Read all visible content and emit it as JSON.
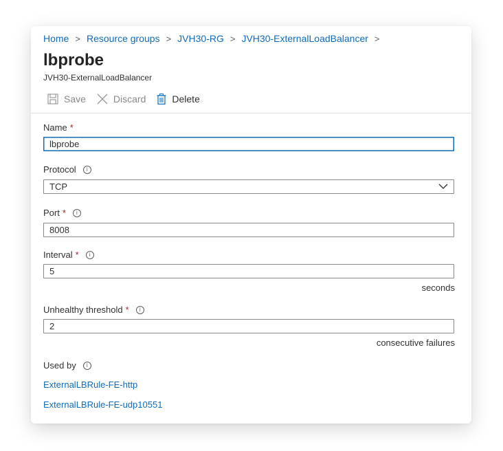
{
  "breadcrumb": [
    "Home",
    "Resource groups",
    "JVH30-RG",
    "JVH30-ExternalLoadBalancer"
  ],
  "breadcrumb_separator": ">",
  "title": "lbprobe",
  "subtitle": "JVH30-ExternalLoadBalancer",
  "toolbar": {
    "save": "Save",
    "discard": "Discard",
    "delete": "Delete"
  },
  "form": {
    "required_mark": "*",
    "info_mark": "i",
    "name": {
      "label": "Name",
      "value": "lbprobe"
    },
    "protocol": {
      "label": "Protocol",
      "value": "TCP"
    },
    "port": {
      "label": "Port",
      "value": "8008"
    },
    "interval": {
      "label": "Interval",
      "value": "5",
      "unit": "seconds"
    },
    "unhealthy": {
      "label": "Unhealthy threshold",
      "value": "2",
      "unit": "consecutive failures"
    },
    "used_by": {
      "label": "Used by",
      "links": [
        "ExternalLBRule-FE-http",
        "ExternalLBRule-FE-udp10551"
      ]
    }
  },
  "colors": {
    "accent": "#0f6cbd",
    "required": "#a4262c"
  },
  "icons": {
    "save": "save-icon",
    "discard": "close-icon",
    "delete": "trash-icon",
    "protocol_dropdown": "chevron-down-icon",
    "breadcrumb_separator": "chevron-right-icon"
  }
}
